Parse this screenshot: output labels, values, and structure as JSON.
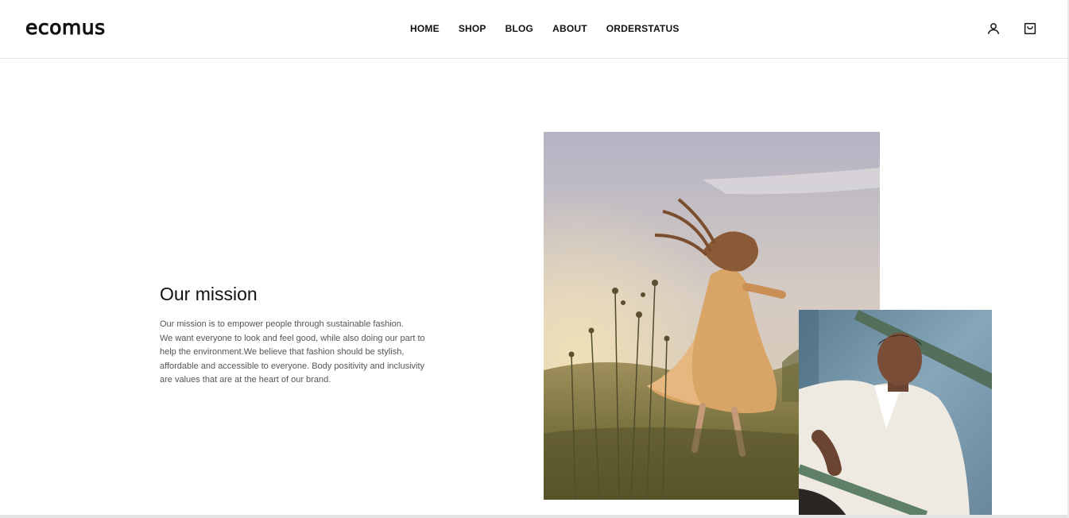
{
  "header": {
    "logo": "ecomus",
    "nav": [
      "HOME",
      "SHOP",
      "BLOG",
      "ABOUT",
      "ORDERSTATUS"
    ],
    "icons": {
      "account": "user-icon",
      "cart": "shopping-bag-icon"
    }
  },
  "mission": {
    "title": "Our mission",
    "lines": [
      "Our mission is to empower people through sustainable fashion.",
      "We want everyone to look and feel good, while also doing our part to",
      "help the environment.We believe that fashion should be stylish,",
      "affordable and accessible to everyone. Body positivity and inclusivity",
      "are values that are at the heart of our brand."
    ]
  },
  "colors": {
    "text": "#111111",
    "body_text": "#555555",
    "border": "#e6e6e6"
  }
}
